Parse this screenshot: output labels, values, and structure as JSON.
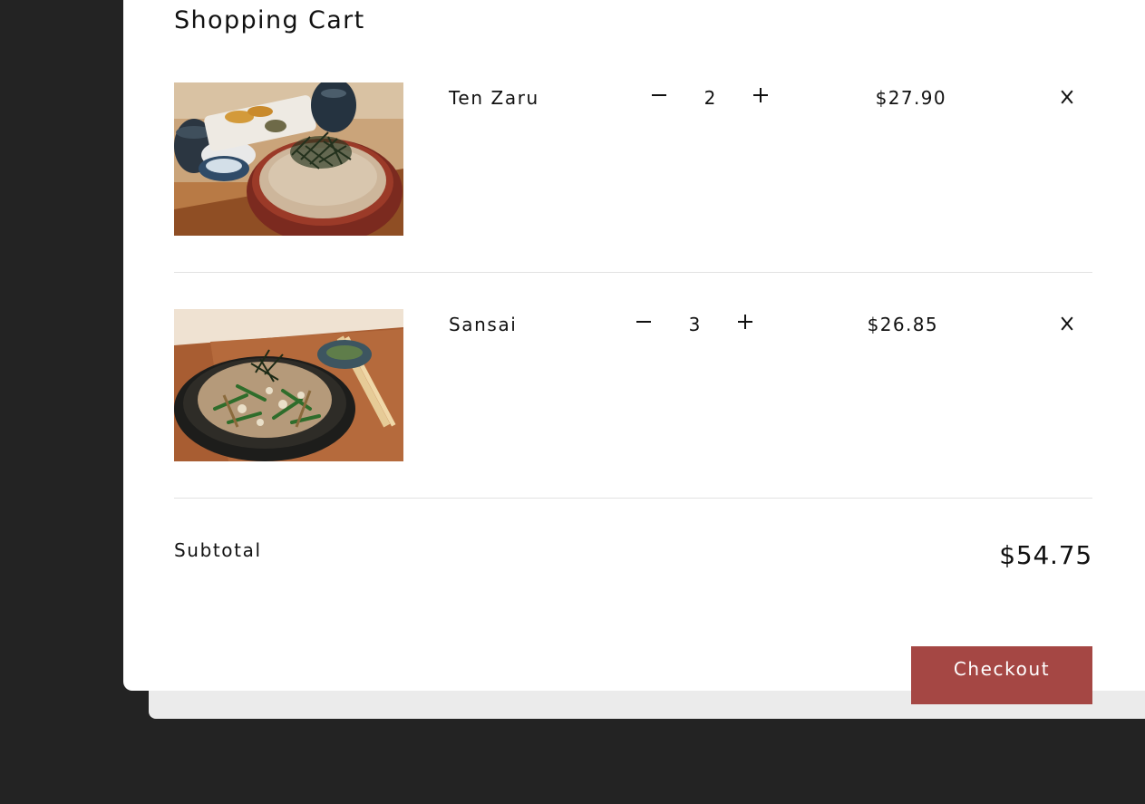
{
  "cart": {
    "title": "Shopping Cart",
    "items": [
      {
        "name": "Ten Zaru",
        "quantity": "2",
        "price": "$27.90",
        "image": "soba-tempura-photo"
      },
      {
        "name": "Sansai",
        "quantity": "3",
        "price": "$26.85",
        "image": "soba-vegetable-bowl-photo"
      }
    ],
    "subtotal_label": "Subtotal",
    "subtotal_value": "$54.75",
    "checkout_label": "Checkout"
  },
  "colors": {
    "backdrop": "#232323",
    "modal": "#ffffff",
    "checkout": "#a54744",
    "divider": "#e2e2e2"
  }
}
